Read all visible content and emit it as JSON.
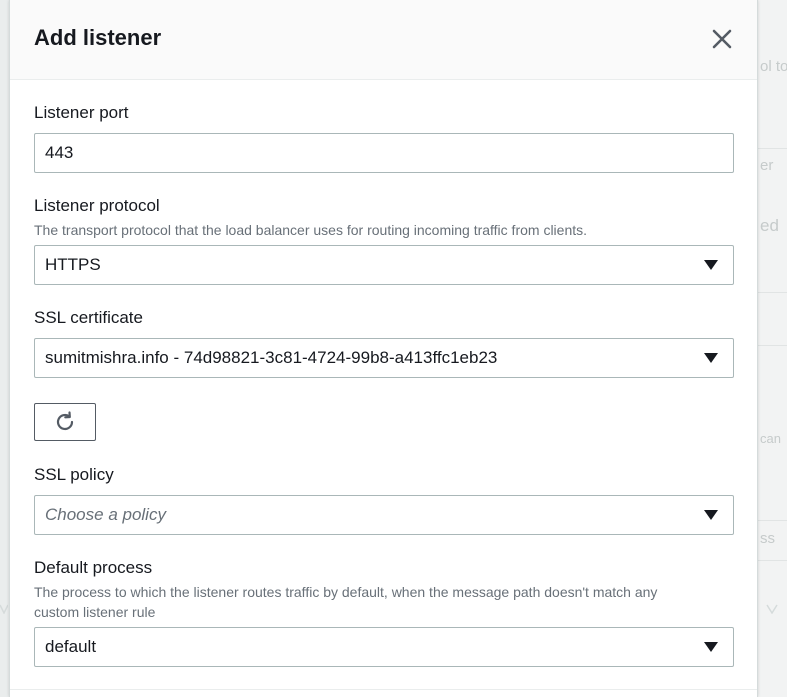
{
  "modal": {
    "title": "Add listener"
  },
  "listener_port": {
    "label": "Listener port",
    "value": "443"
  },
  "listener_protocol": {
    "label": "Listener protocol",
    "description": "The transport protocol that the load balancer uses for routing incoming traffic from clients.",
    "value": "HTTPS"
  },
  "ssl_certificate": {
    "label": "SSL certificate",
    "value": "sumitmishra.info - 74d98821-3c81-4724-99b8-a413ffc1eb23"
  },
  "ssl_policy": {
    "label": "SSL policy",
    "placeholder": "Choose a policy"
  },
  "default_process": {
    "label": "Default process",
    "description_line1": "The process to which the listener routes traffic by default, when the message path doesn't match any",
    "description_line2": "custom listener rule",
    "value": "default"
  },
  "background": {
    "fragment_1": "ol to",
    "fragment_2": "er",
    "fragment_3": "ed",
    "fragment_4": "can",
    "fragment_5": "ss"
  },
  "icons": {
    "close": "close-icon",
    "refresh": "refresh-icon",
    "caret": "caret-down-icon"
  }
}
